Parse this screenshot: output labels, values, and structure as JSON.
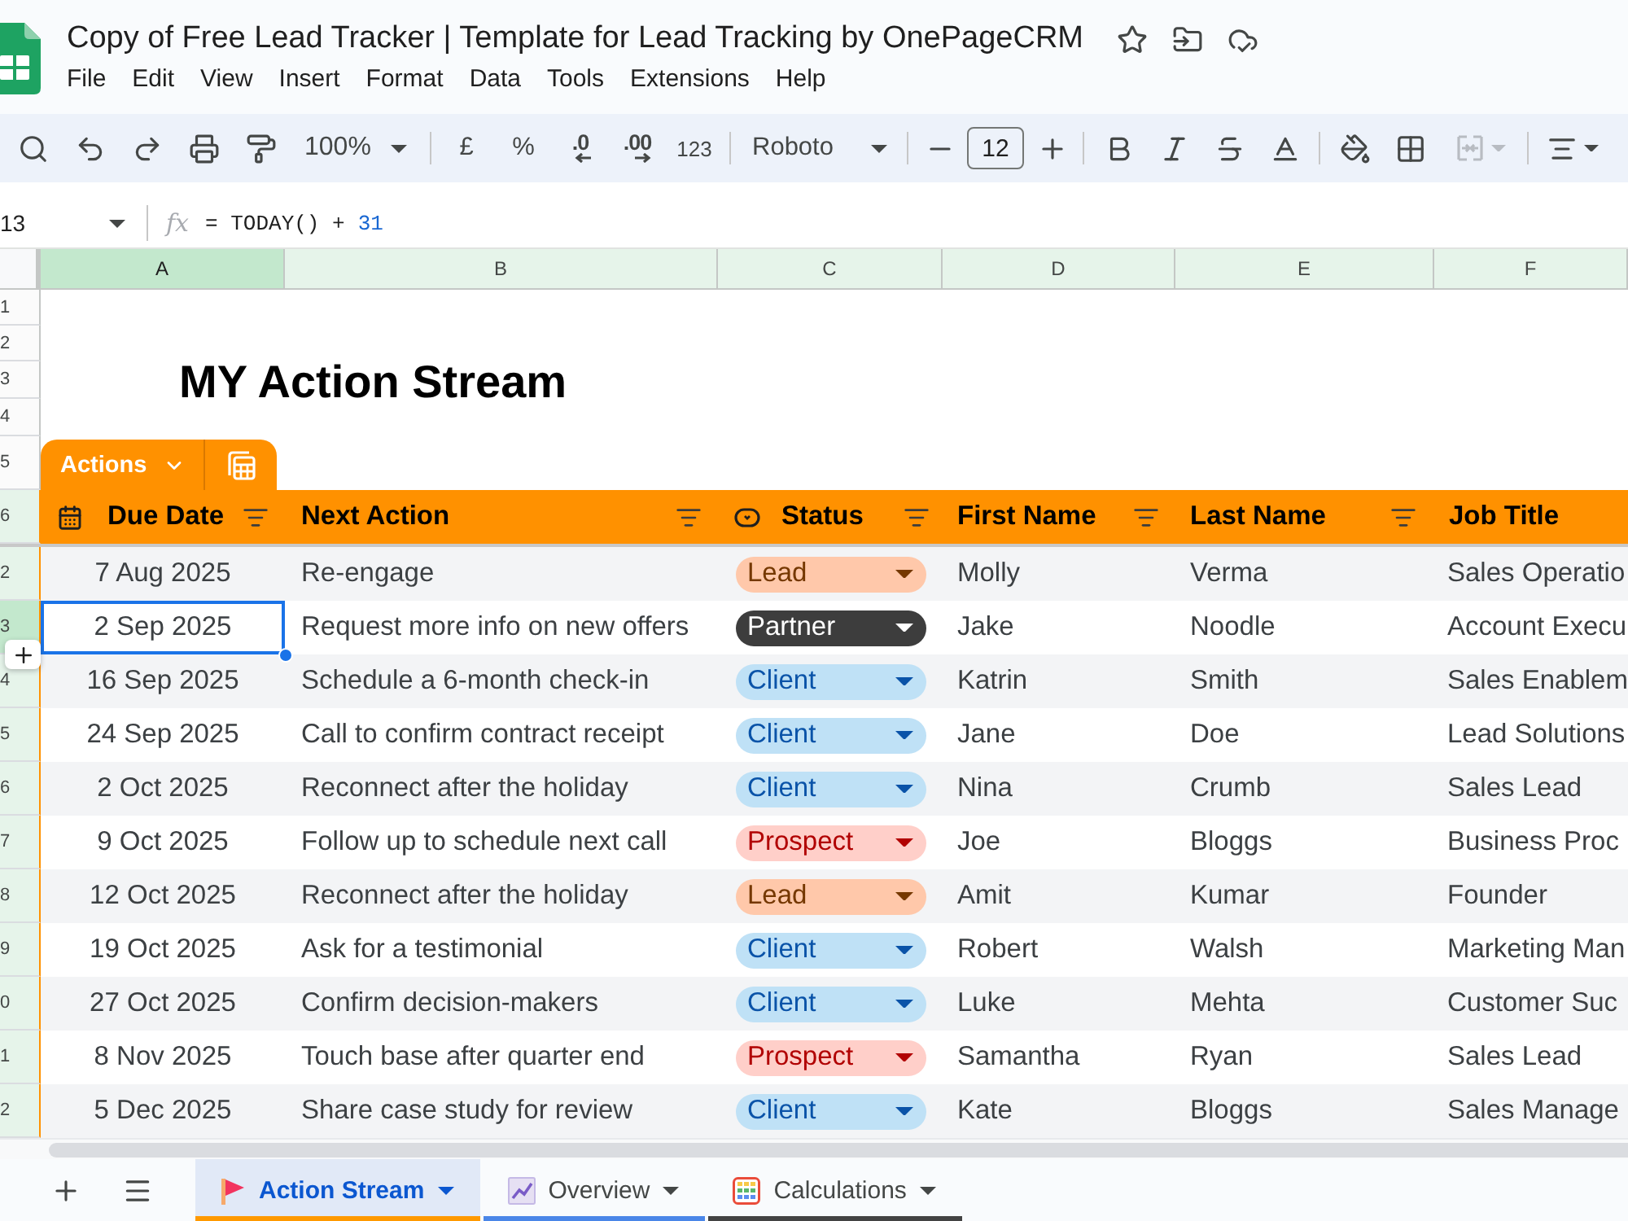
{
  "document": {
    "title": "Copy of Free Lead Tracker | Template for Lead Tracking by OnePageCRM",
    "menu": [
      "File",
      "Edit",
      "View",
      "Insert",
      "Format",
      "Data",
      "Tools",
      "Extensions",
      "Help"
    ]
  },
  "toolbar": {
    "zoom": "100%",
    "currency": "£",
    "percent": "%",
    "decrease_decimal": ".0",
    "increase_decimal": ".00",
    "number_format": "123",
    "font": "Roboto",
    "font_size": "12",
    "merge_cells": {
      "disabled": true
    }
  },
  "formula_bar": {
    "name_box": "13",
    "function_label": "fx",
    "formula": [
      {
        "kind": "text",
        "text": "= TODAY() +"
      },
      {
        "kind": "number",
        "text": "31"
      }
    ]
  },
  "grid": {
    "columns": [
      {
        "label": "A",
        "selected": true
      },
      {
        "label": "B",
        "selected": false
      },
      {
        "label": "C",
        "selected": false
      },
      {
        "label": "D",
        "selected": false
      },
      {
        "label": "E",
        "selected": false
      },
      {
        "label": "F",
        "selected": false
      }
    ],
    "top_rows": [
      "1",
      "2",
      "3",
      "4",
      "5"
    ],
    "title": "MY Action Stream"
  },
  "table": {
    "name": "Actions",
    "header_row": "6",
    "columns": [
      {
        "label": "Due Date",
        "kind": "date"
      },
      {
        "label": "Next Action",
        "kind": "text"
      },
      {
        "label": "Status",
        "kind": "dropdown"
      },
      {
        "label": "First Name",
        "kind": "text"
      },
      {
        "label": "Last Name",
        "kind": "text"
      },
      {
        "label": "Job Title",
        "kind": "text"
      }
    ],
    "rows": [
      {
        "row": "2",
        "selected": false,
        "due_date": "7 Aug 2025",
        "next_action": "Re-engage",
        "status": {
          "label": "Lead",
          "kind": "lead"
        },
        "first_name": "Molly",
        "last_name": "Verma",
        "job_title": "Sales Operatio"
      },
      {
        "row": "3",
        "selected": true,
        "due_date": "2 Sep 2025",
        "next_action": "Request more info on new offers",
        "status": {
          "label": "Partner",
          "kind": "partner"
        },
        "first_name": "Jake",
        "last_name": "Noodle",
        "job_title": "Account Execu"
      },
      {
        "row": "4",
        "selected": false,
        "due_date": "16 Sep 2025",
        "next_action": "Schedule a 6-month check-in",
        "status": {
          "label": "Client",
          "kind": "client"
        },
        "first_name": "Katrin",
        "last_name": "Smith",
        "job_title": "Sales Enablem"
      },
      {
        "row": "5",
        "selected": false,
        "due_date": "24 Sep 2025",
        "next_action": "Call to confirm contract receipt",
        "status": {
          "label": "Client",
          "kind": "client"
        },
        "first_name": "Jane",
        "last_name": "Doe",
        "job_title": "Lead Solutions"
      },
      {
        "row": "6",
        "selected": false,
        "due_date": "2 Oct 2025",
        "next_action": "Reconnect after the holiday",
        "status": {
          "label": "Client",
          "kind": "client"
        },
        "first_name": "Nina",
        "last_name": "Crumb",
        "job_title": "Sales Lead"
      },
      {
        "row": "7",
        "selected": false,
        "due_date": "9 Oct 2025",
        "next_action": "Follow up to schedule next call",
        "status": {
          "label": "Prospect",
          "kind": "prospect"
        },
        "first_name": "Joe",
        "last_name": "Bloggs",
        "job_title": "Business Proc"
      },
      {
        "row": "8",
        "selected": false,
        "due_date": "12 Oct 2025",
        "next_action": "Reconnect after the holiday",
        "status": {
          "label": "Lead",
          "kind": "lead"
        },
        "first_name": "Amit",
        "last_name": "Kumar",
        "job_title": "Founder"
      },
      {
        "row": "9",
        "selected": false,
        "due_date": "19 Oct 2025",
        "next_action": "Ask for a testimonial",
        "status": {
          "label": "Client",
          "kind": "client"
        },
        "first_name": "Robert",
        "last_name": "Walsh",
        "job_title": "Marketing Man"
      },
      {
        "row": "0",
        "selected": false,
        "due_date": "27 Oct 2025",
        "next_action": "Confirm decision-makers",
        "status": {
          "label": "Client",
          "kind": "client"
        },
        "first_name": "Luke",
        "last_name": "Mehta",
        "job_title": "Customer Suc"
      },
      {
        "row": "1",
        "selected": false,
        "due_date": "8 Nov 2025",
        "next_action": "Touch base after quarter end",
        "status": {
          "label": "Prospect",
          "kind": "prospect"
        },
        "first_name": "Samantha",
        "last_name": "Ryan",
        "job_title": "Sales Lead"
      },
      {
        "row": "2",
        "selected": false,
        "due_date": "5 Dec 2025",
        "next_action": "Share case study for review",
        "status": {
          "label": "Client",
          "kind": "client"
        },
        "first_name": "Kate",
        "last_name": "Bloggs",
        "job_title": "Sales Manage"
      }
    ]
  },
  "sheet_tabs": [
    {
      "label": "Action Stream",
      "selected": true,
      "color": "#ff9900"
    },
    {
      "label": "Overview",
      "selected": false,
      "color": "#4a86e8"
    },
    {
      "label": "Calculations",
      "selected": false,
      "color": "#434343"
    }
  ]
}
